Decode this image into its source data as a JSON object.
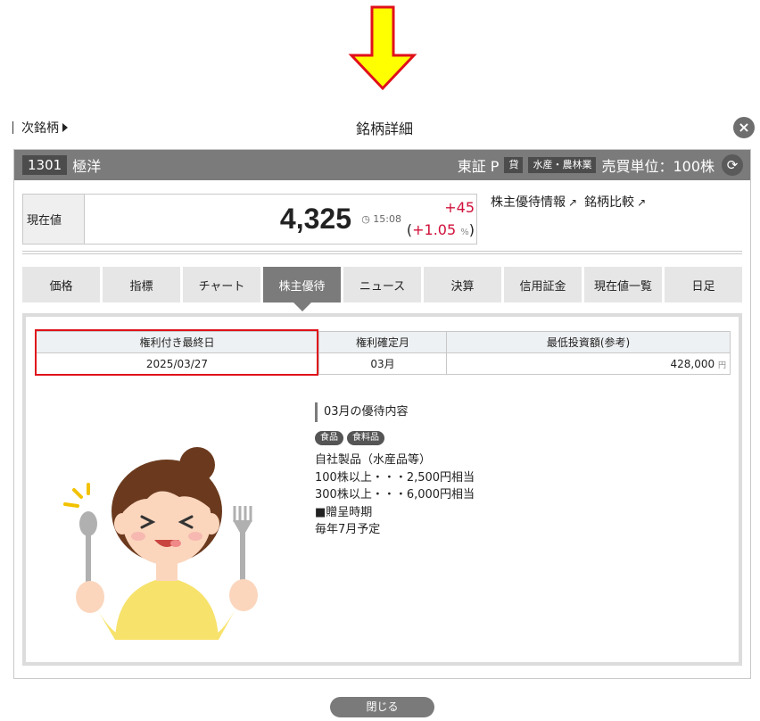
{
  "colors": {
    "arrow_fill": "#ffff00",
    "arrow_stroke": "#e0101a",
    "header_bg": "#7b7b7b",
    "price_up": "#d0103a",
    "highlight_border": "#e0101a"
  },
  "topbar": {
    "next_label": "次銘柄",
    "title": "銘柄詳細",
    "close_icon": "close-icon"
  },
  "header": {
    "code": "1301",
    "name": "極洋",
    "market": "東証 P",
    "badge_lend": "貸",
    "sector": "水産・農林業",
    "trade_unit": "売買単位：100株",
    "refresh_icon": "refresh-icon"
  },
  "price": {
    "label": "現在値",
    "value": "4,325",
    "time": "15:08",
    "change": "+45",
    "change_pct": "+1.05",
    "pct_unit": "%"
  },
  "links": {
    "benefit_info": "株主優待情報",
    "compare": "銘柄比較"
  },
  "tabs": [
    "価格",
    "指標",
    "チャート",
    "株主優待",
    "ニュース",
    "決算",
    "信用証金",
    "現在値一覧",
    "日足"
  ],
  "info_table": {
    "headers": [
      "権利付き最終日",
      "権利確定月",
      "最低投資額(参考)"
    ],
    "last_date": "2025/03/27",
    "month": "03月",
    "min_invest": "428,000",
    "yen": "円"
  },
  "benefit": {
    "title": "03月の優待内容",
    "tags": [
      "食品",
      "食料品"
    ],
    "lines": [
      "自社製品（水産品等）",
      "100株以上・・・2,500円相当",
      "300株以上・・・6,000円相当",
      "■贈呈時期",
      "毎年7月予定"
    ]
  },
  "footer": {
    "close_label": "閉じる"
  }
}
